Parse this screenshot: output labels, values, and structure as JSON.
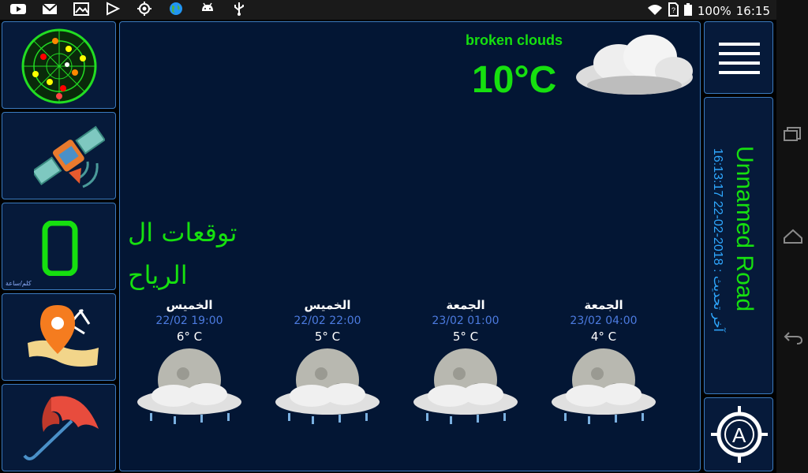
{
  "status": {
    "battery": "100%",
    "time": "16:15"
  },
  "weather": {
    "condition": "broken clouds",
    "temperature": "10°C"
  },
  "wind_title_line1": "توقعات ال",
  "wind_title_line2": "الرياح",
  "speed": {
    "value": "0",
    "unit": "كلم/ساعة"
  },
  "location": {
    "name": "Unnamed Road",
    "updated": "آخر تحديث : 2018-02-22 16:13:17"
  },
  "forecast": [
    {
      "day": "الخميس",
      "time": "22/02 19:00",
      "temp": "6° C"
    },
    {
      "day": "الخميس",
      "time": "22/02 22:00",
      "temp": "5° C"
    },
    {
      "day": "الجمعة",
      "time": "23/02 01:00",
      "temp": "5° C"
    },
    {
      "day": "الجمعة",
      "time": "23/02 04:00",
      "temp": "4° C"
    }
  ],
  "colors": {
    "accent_green": "#16e00f",
    "panel_bg": "#061a3a",
    "border": "#3b7bbf",
    "time_blue": "#4c7be0"
  },
  "icons": {
    "left_panel": [
      "compass-grid-icon",
      "satellite-icon",
      "speedometer-icon",
      "map-pin-icon",
      "umbrella-icon"
    ],
    "right_panel": [
      "menu-icon",
      "target-a-icon"
    ]
  }
}
